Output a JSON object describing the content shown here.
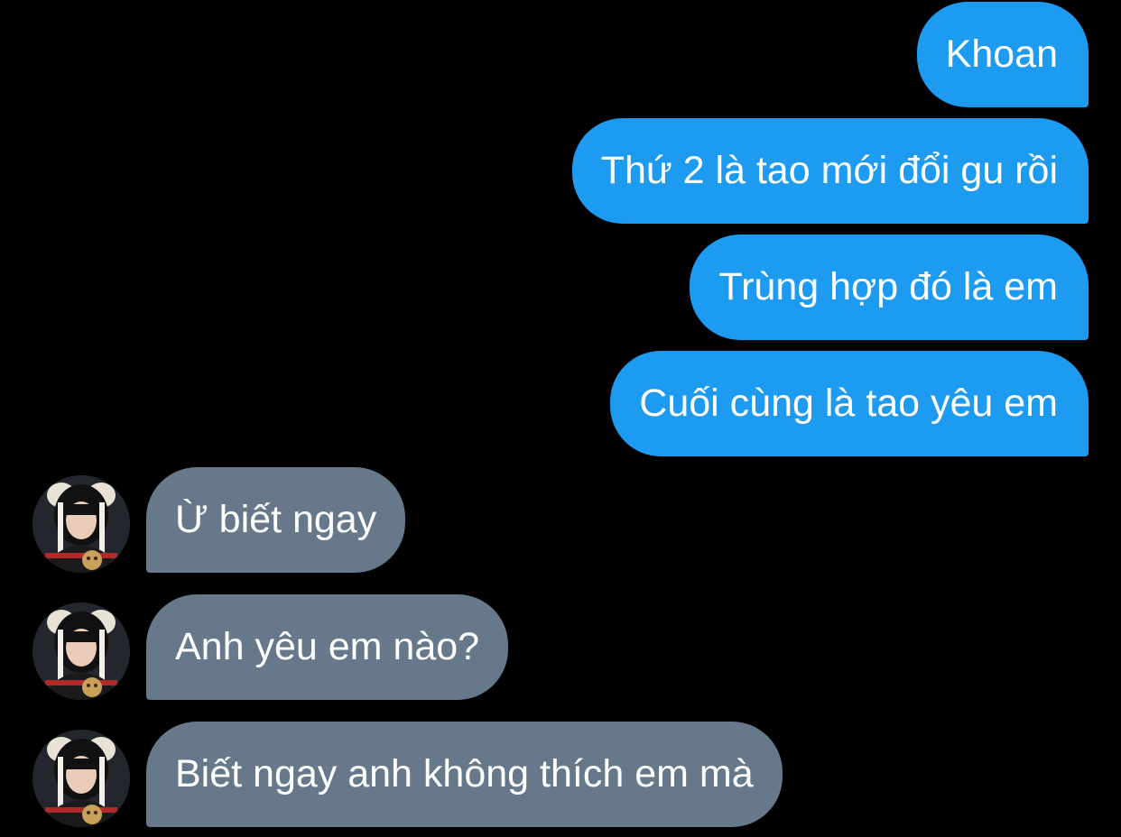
{
  "colors": {
    "background": "#000000",
    "outgoing_bubble": "#1d9bf0",
    "incoming_bubble": "#66788a",
    "bubble_text": "#ffffff"
  },
  "messages": [
    {
      "direction": "outgoing",
      "text": "Khoan"
    },
    {
      "direction": "outgoing",
      "text": "Thứ 2 là tao mới đổi gu rồi"
    },
    {
      "direction": "outgoing",
      "text": "Trùng hợp đó là em"
    },
    {
      "direction": "outgoing",
      "text": "Cuối cùng là tao yêu em"
    },
    {
      "direction": "incoming",
      "text": "Ừ biết ngay",
      "avatar": "user-avatar"
    },
    {
      "direction": "incoming",
      "text": "Anh yêu em nào?",
      "avatar": "user-avatar"
    },
    {
      "direction": "incoming",
      "text": "Biết ngay anh không thích em mà",
      "avatar": "user-avatar"
    }
  ]
}
